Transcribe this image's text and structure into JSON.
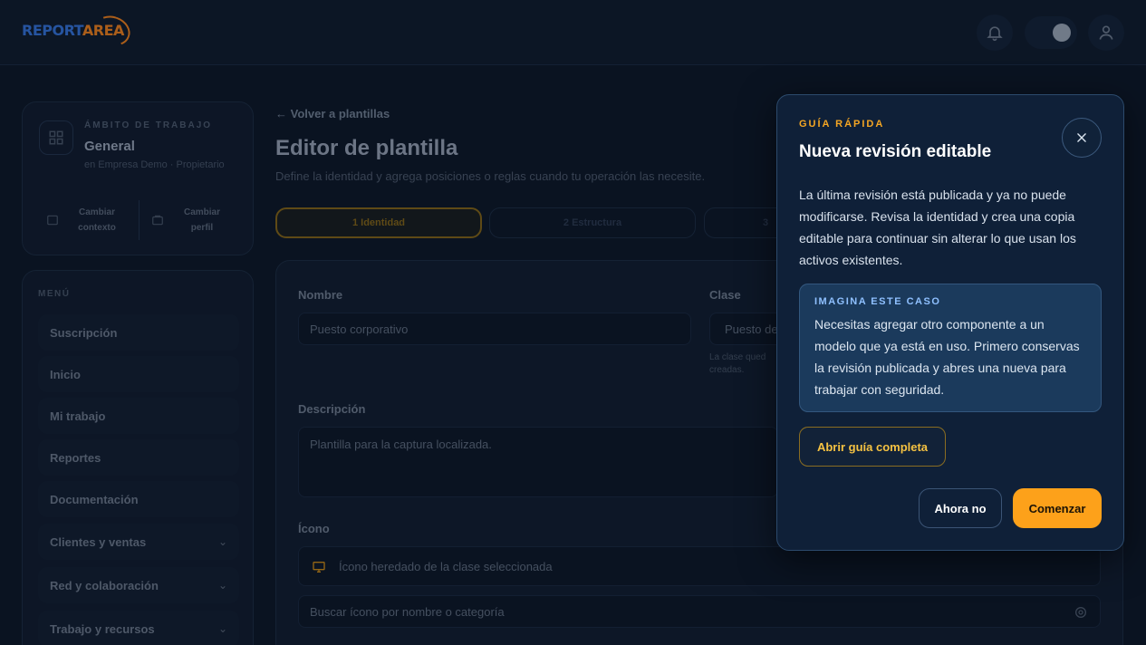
{
  "header": {
    "logo_part1": "REPORT",
    "logo_part2": "AREA",
    "bell_icon": "bell-icon",
    "theme_icon": "moon-icon",
    "user_icon": "user-icon"
  },
  "context": {
    "kicker": "ÁMBITO DE TRABAJO",
    "title": "General",
    "subtitle": "en Empresa Demo · Propietario",
    "change_context": "Cambiar contexto",
    "change_profile": "Cambiar perfil"
  },
  "menu": {
    "kicker": "MENÚ",
    "items": [
      {
        "label": "Suscripción",
        "expandable": false
      },
      {
        "label": "Inicio",
        "expandable": false
      },
      {
        "label": "Mi trabajo",
        "expandable": false
      },
      {
        "label": "Reportes",
        "expandable": false
      },
      {
        "label": "Documentación",
        "expandable": false
      },
      {
        "label": "Clientes y ventas",
        "expandable": true
      },
      {
        "label": "Red y colaboración",
        "expandable": true
      },
      {
        "label": "Trabajo y recursos",
        "expandable": true
      }
    ],
    "chevron": "⌄"
  },
  "editor": {
    "back": "← Volver a plantillas",
    "title": "Editor de plantilla",
    "subtitle": "Define la identidad y agrega posiciones o reglas cuando tu operación las necesite.",
    "steps": [
      "1 Identidad",
      "2 Estructura",
      "3"
    ],
    "name_label": "Nombre",
    "name_value": "Puesto corporativo",
    "class_label": "Clase",
    "class_value": "Puesto de",
    "class_help": "La clase qued creadas.",
    "desc_label": "Descripción",
    "desc_value": "Plantilla para la captura localizada.",
    "icon_label": "Ícono",
    "icon_value": "Ícono heredado de la clase seleccionada",
    "icon_search_placeholder": "Buscar ícono por nombre o categoría"
  },
  "modal": {
    "kicker": "GUÍA RÁPIDA",
    "title": "Nueva revisión editable",
    "body": "La última revisión está publicada y ya no puede modificarse. Revisa la identidad y crea una copia editable para continuar sin alterar lo que usan los activos existentes.",
    "case_kicker": "IMAGINA ESTE CASO",
    "case_body": "Necesitas agregar otro componente a un modelo que ya está en uso. Primero conservas la revisión publicada y abres una nueva para trabajar con seguridad.",
    "guide_button": "Abrir guía completa",
    "later_button": "Ahora no",
    "start_button": "Comenzar"
  },
  "colors": {
    "accent": "#fda11a",
    "kicker": "#f5a623",
    "case_kicker": "#8fc0ff",
    "modal_bg": "#0f2038"
  }
}
